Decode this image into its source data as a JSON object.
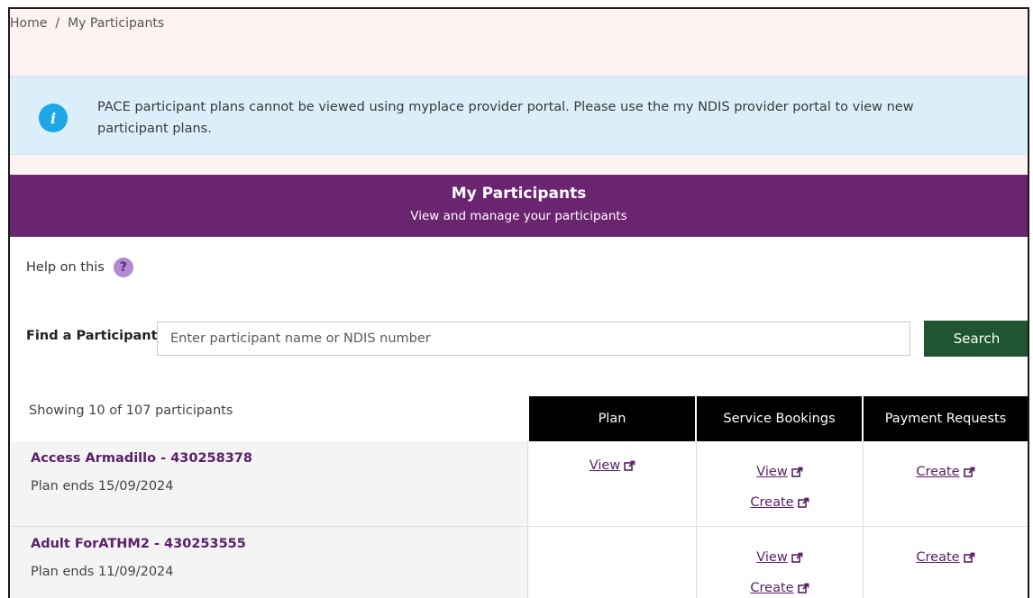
{
  "breadcrumb": {
    "home": "Home",
    "separator": "/",
    "current": "My Participants"
  },
  "banner": {
    "icon": "info-icon",
    "icon_glyph": "i",
    "text": "PACE participant plans cannot be viewed using myplace provider portal. Please use the my NDIS provider portal to view new participant plans."
  },
  "hero": {
    "title": "My Participants",
    "subtitle": "View and manage your participants"
  },
  "help": {
    "label": "Help on this",
    "icon_glyph": "?"
  },
  "search": {
    "label": "Find a Participant",
    "placeholder": "Enter participant name or NDIS number",
    "value": "",
    "button": "Search"
  },
  "table": {
    "showing": "Showing 10 of 107 participants",
    "columns": {
      "plan": "Plan",
      "service_bookings": "Service Bookings",
      "payment_requests": "Payment Requests"
    },
    "rows": [
      {
        "name": "Access Armadillo - 430258378",
        "plan_ends": "Plan ends 15/09/2024",
        "plan_link": "View",
        "sb_view": "View",
        "sb_create": "Create",
        "pr_link": "Create"
      },
      {
        "name": "Adult ForATHM2 - 430253555",
        "plan_ends": "Plan ends 11/09/2024",
        "plan_link": "",
        "sb_view": "View",
        "sb_create": "Create",
        "pr_link": "Create"
      }
    ]
  },
  "colors": {
    "hero_purple": "#6b2470",
    "link_purple": "#5a2068",
    "search_green": "#1f5631",
    "info_blue": "#1ea7e6",
    "banner_bg": "#dbeef9",
    "header_black": "#000000"
  }
}
